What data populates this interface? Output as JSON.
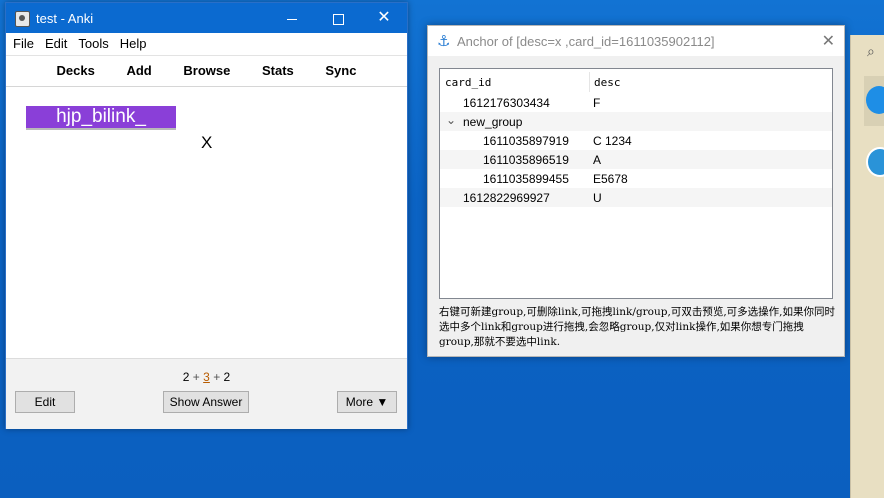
{
  "anki": {
    "title": "test - Anki",
    "menu": [
      "File",
      "Edit",
      "Tools",
      "Help"
    ],
    "toolbar": [
      "Decks",
      "Add",
      "Browse",
      "Stats",
      "Sync"
    ],
    "card": {
      "front_tag": "hjp_bilink_",
      "text": "X",
      "tag_color": "#8a3fd8"
    },
    "counts": {
      "new": "2",
      "learn": "3",
      "review": "2",
      "plus": "+"
    },
    "buttons": {
      "edit": "Edit",
      "show_answer": "Show Answer",
      "more": "More ▼"
    }
  },
  "anchor": {
    "title": "Anchor of [desc=x ,card_id=1611035902112]",
    "columns": {
      "card_id": "card_id",
      "desc": "desc"
    },
    "rows": [
      {
        "id": "1612176303434",
        "desc": "F"
      },
      {
        "group": "new_group"
      },
      {
        "id": "1611035897919",
        "desc": "C 1234"
      },
      {
        "id": "1611035896519",
        "desc": "A"
      },
      {
        "id": "1611035899455",
        "desc": "E5678"
      },
      {
        "id": "1612822969927",
        "desc": "U"
      }
    ],
    "hint": "右键可新建group,可删除link,可拖拽link/group,可双击预览,可多选操作,如果你同时选中多个link和group进行拖拽,会忽略group,仅对link操作,如果你想专门拖拽group,那就不要选中link."
  },
  "colors": {
    "desktop": "#0d63bf",
    "titlebar": "#0b6ad0",
    "accent": "#2c7fd4"
  },
  "icons": [
    "anki-app-icon",
    "anchor-icon",
    "search-icon",
    "chevron-down-icon"
  ]
}
